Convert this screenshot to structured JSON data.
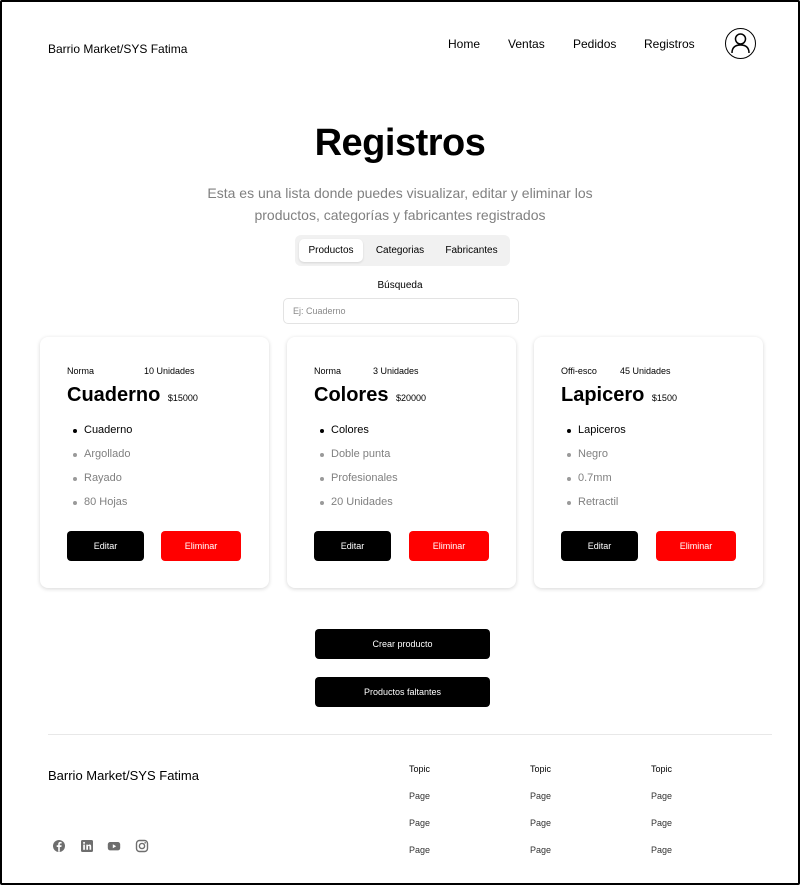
{
  "header": {
    "brand": "Barrio Market/SYS Fatima",
    "nav": [
      "Home",
      "Ventas",
      "Pedidos",
      "Registros"
    ]
  },
  "hero": {
    "title": "Registros",
    "subtitle_line1": "Esta es una lista donde puedes visualizar, editar y eliminar los",
    "subtitle_line2": "productos, categorías y fabricantes registrados"
  },
  "tabs": [
    {
      "label": "Productos",
      "active": true
    },
    {
      "label": "Categorias",
      "active": false
    },
    {
      "label": "Fabricantes",
      "active": false
    }
  ],
  "search": {
    "label": "Búsqueda",
    "placeholder": "Ej: Cuaderno"
  },
  "products": [
    {
      "category": "Norma",
      "units": "10 Unidades",
      "name": "Cuaderno",
      "price": "$15000",
      "features": [
        "Cuaderno",
        "Argollado",
        "Rayado",
        "80 Hojas"
      ],
      "edit_label": "Editar",
      "delete_label": "Eliminar"
    },
    {
      "category": "Norma",
      "units": "3 Unidades",
      "name": "Colores",
      "price": "$20000",
      "features": [
        "Colores",
        "Doble punta",
        "Profesionales",
        "20 Unidades"
      ],
      "edit_label": "Editar",
      "delete_label": "Eliminar"
    },
    {
      "category": "Offi-esco",
      "units": "45 Unidades",
      "name": "Lapicero",
      "price": "$1500",
      "features": [
        "Lapiceros",
        "Negro",
        "0.7mm",
        "Retractil"
      ],
      "edit_label": "Editar",
      "delete_label": "Eliminar"
    }
  ],
  "actions": {
    "create": "Crear producto",
    "missing": "Productos faltantes"
  },
  "footer": {
    "brand": "Barrio Market/SYS Fatima",
    "social_icons": [
      "facebook-icon",
      "linkedin-icon",
      "youtube-icon",
      "instagram-icon"
    ],
    "columns": [
      {
        "topic": "Topic",
        "links": [
          "Page",
          "Page",
          "Page"
        ]
      },
      {
        "topic": "Topic",
        "links": [
          "Page",
          "Page",
          "Page"
        ]
      },
      {
        "topic": "Topic",
        "links": [
          "Page",
          "Page",
          "Page"
        ]
      }
    ]
  },
  "colors": {
    "primary": "#000000",
    "danger": "#ff0000",
    "muted_text": "#808080",
    "tabs_bg": "#f1f1f1"
  }
}
